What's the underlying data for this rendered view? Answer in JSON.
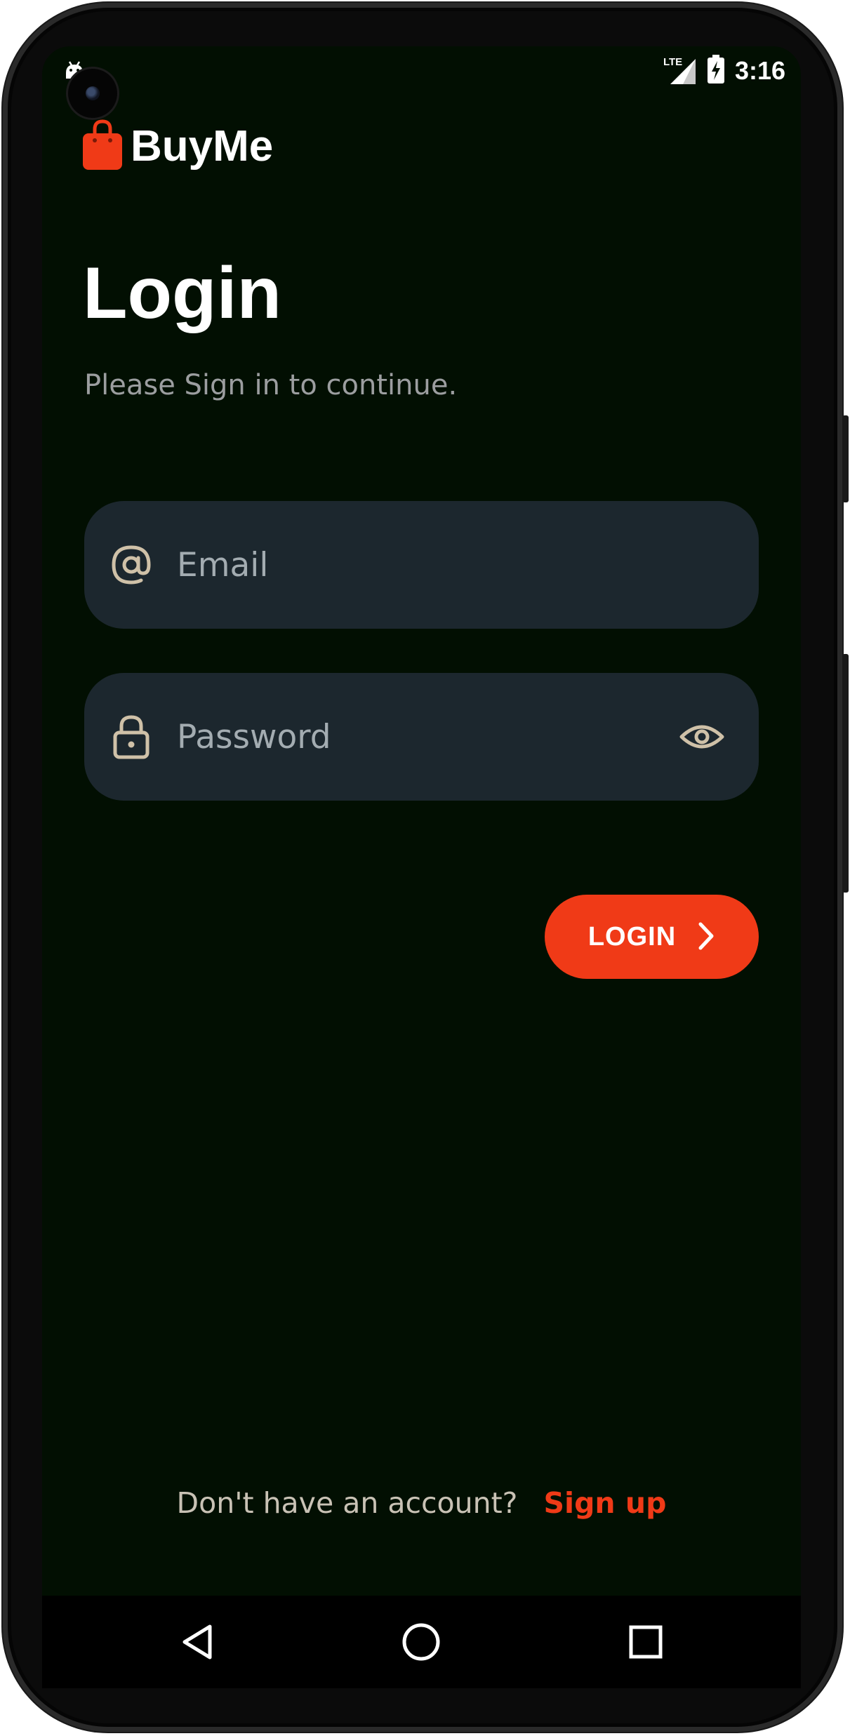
{
  "status_bar": {
    "time": "3:16",
    "network_label": "LTE",
    "left_icon": "android-debug-icon",
    "icons": [
      "lte-signal-icon",
      "battery-charging-icon"
    ]
  },
  "app": {
    "brand_name": "BuyMe",
    "brand_icon": "shopping-bag-icon",
    "accent_color": "#f03a17"
  },
  "login": {
    "title": "Login",
    "subtitle": "Please Sign in to continue.",
    "email": {
      "placeholder": "Email",
      "value": "",
      "icon": "at-sign-icon"
    },
    "password": {
      "placeholder": "Password",
      "value": "",
      "icon": "lock-icon",
      "toggle_icon": "eye-icon"
    },
    "button_label": "LOGIN",
    "button_icon": "chevron-right-icon"
  },
  "footer": {
    "prompt": "Don't have an account?",
    "signup_label": "Sign up"
  },
  "navigation": {
    "buttons": [
      "back-icon",
      "home-icon",
      "recent-apps-icon"
    ]
  }
}
